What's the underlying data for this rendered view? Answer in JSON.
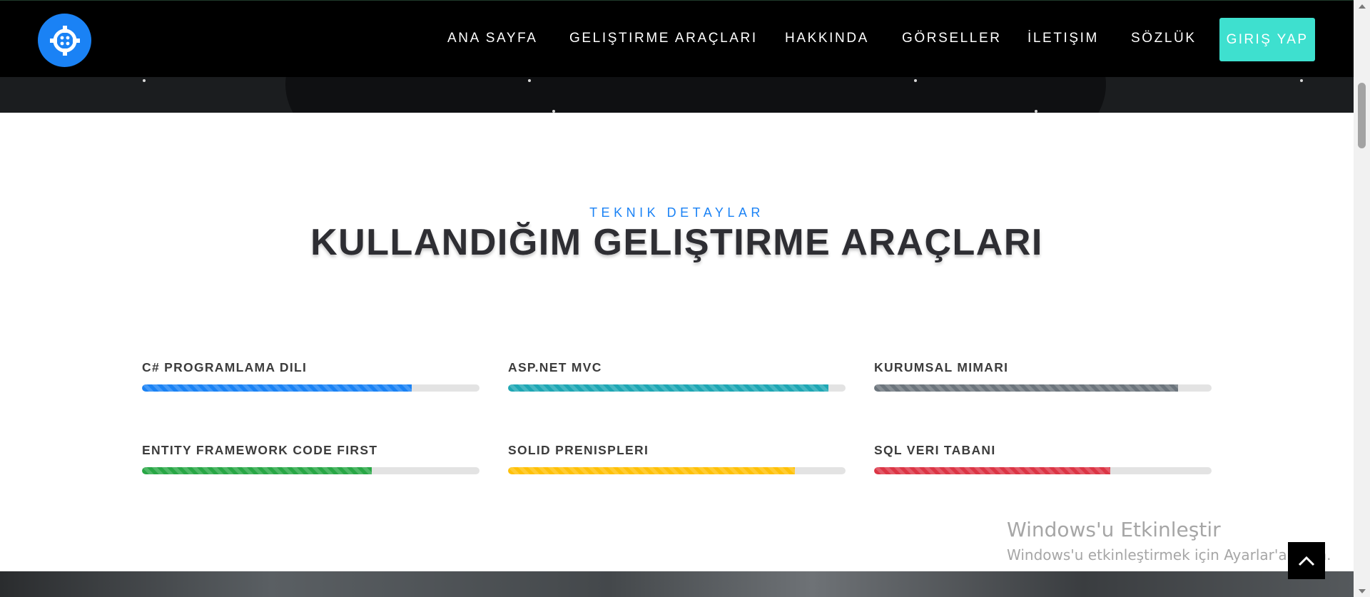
{
  "nav": {
    "logo_icon": "crosshair-icon",
    "links": [
      "ANA SAYFA",
      "GELIŞTIRME ARAÇLARI",
      "HAKKINDA",
      "GÖRSELLER",
      "İLETIŞIM",
      "SÖZLÜK"
    ],
    "login_label": "GIRIŞ YAP"
  },
  "section": {
    "eyebrow": "TEKNIK DETAYLAR",
    "title": "KULLANDIĞIM GELIŞTIRME ARAÇLARI"
  },
  "skills": [
    {
      "label": "C# PROGRAMLAMA DILI",
      "progress": 0.8,
      "color": "#1a82f5"
    },
    {
      "label": "ASP.NET MVC",
      "progress": 0.95,
      "color": "#1ea7b4"
    },
    {
      "label": "KURUMSAL MIMARI",
      "progress": 0.9,
      "color": "#6c757d"
    },
    {
      "label": "ENTITY FRAMEWORK CODE FIRST",
      "progress": 0.68,
      "color": "#28a745"
    },
    {
      "label": "SOLID PRENISPLERI",
      "progress": 0.85,
      "color": "#ffc107"
    },
    {
      "label": "SQL VERI TABANI",
      "progress": 0.7,
      "color": "#dc3545"
    }
  ],
  "watermark": {
    "title": "Windows'u Etkinleştir",
    "subtitle": "Windows'u etkinleştirmek için Ayarlar'a gidin."
  },
  "back_to_top_icon": "chevron-up-icon"
}
